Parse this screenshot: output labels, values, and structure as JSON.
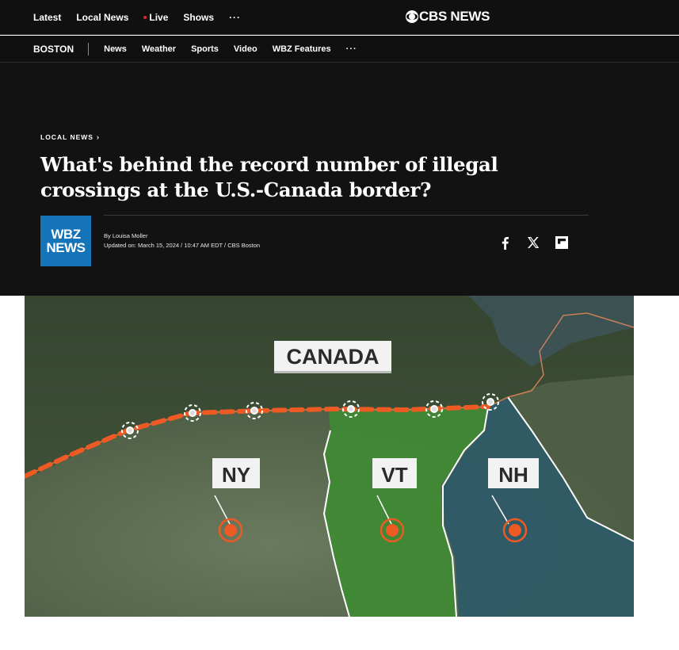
{
  "top_nav": {
    "items": [
      "Latest",
      "Local News",
      "Live",
      "Shows"
    ],
    "more": "···",
    "brand": "CBS NEWS",
    "live_color": "#e5252b"
  },
  "sub_nav": {
    "city": "BOSTON",
    "items": [
      "News",
      "Weather",
      "Sports",
      "Video",
      "WBZ Features"
    ],
    "more": "···"
  },
  "article": {
    "kicker": "LOCAL NEWS",
    "kicker_chevron": "›",
    "headline_line1": "What's behind the record number of illegal",
    "headline_line2": "crossings at the U.S.-Canada border?",
    "logo_line1": "WBZ",
    "logo_line2": "NEWS",
    "logo_color": "#1573b8",
    "author": "By Louisa Moller",
    "updated": "Updated on: March 15, 2024 / 10:47 AM EDT / CBS Boston",
    "share": [
      "facebook-icon",
      "x-icon",
      "flipboard-icon"
    ]
  },
  "map": {
    "country_label": "CANADA",
    "states": [
      "NY",
      "VT",
      "NH"
    ],
    "border_color": "#ee5a24",
    "vt_color": "#3f8a34",
    "nh_color": "#2e5a66"
  }
}
